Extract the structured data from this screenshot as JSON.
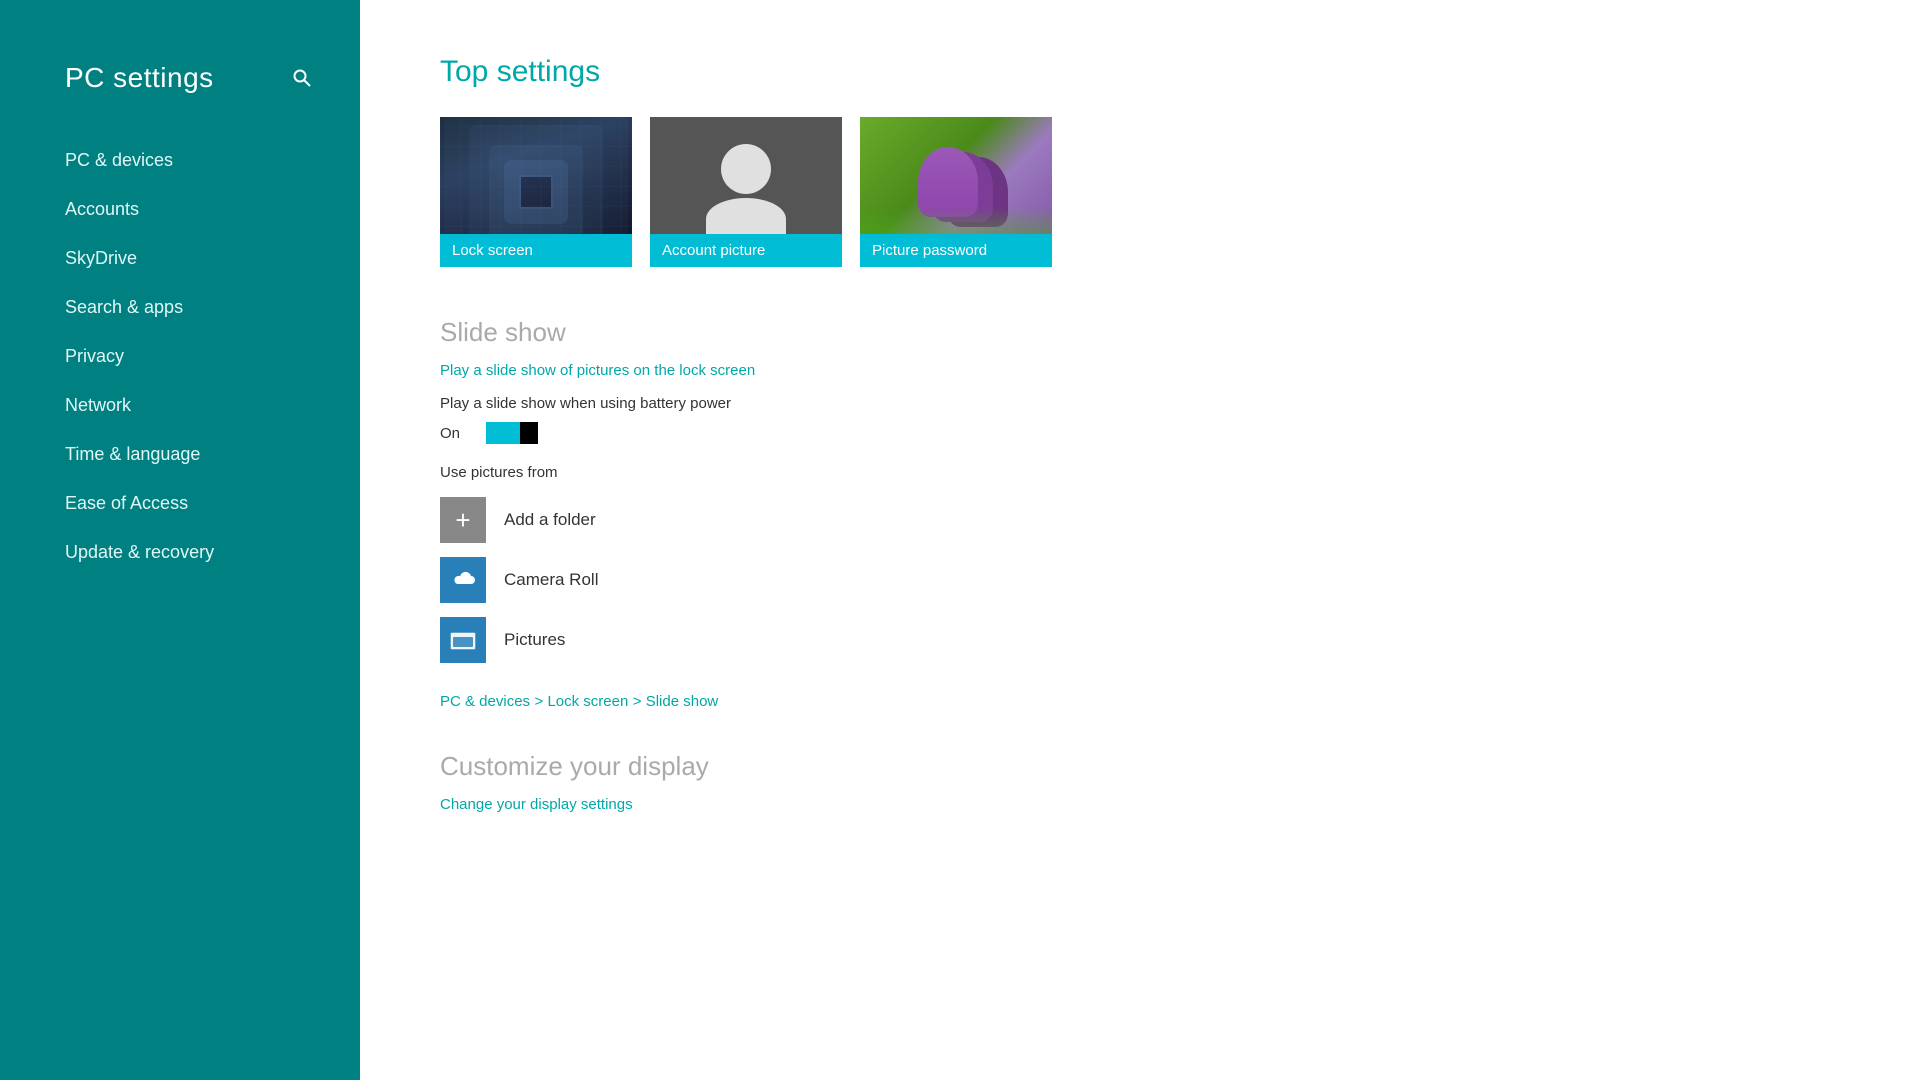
{
  "sidebar": {
    "title": "PC settings",
    "search_icon": "🔍",
    "nav_items": [
      {
        "id": "pc-devices",
        "label": "PC & devices",
        "active": false
      },
      {
        "id": "accounts",
        "label": "Accounts",
        "active": false
      },
      {
        "id": "skydrive",
        "label": "SkyDrive",
        "active": false
      },
      {
        "id": "search-apps",
        "label": "Search & apps",
        "active": false
      },
      {
        "id": "privacy",
        "label": "Privacy",
        "active": false
      },
      {
        "id": "network",
        "label": "Network",
        "active": false
      },
      {
        "id": "time-language",
        "label": "Time & language",
        "active": false
      },
      {
        "id": "ease-of-access",
        "label": "Ease of Access",
        "active": false
      },
      {
        "id": "update-recovery",
        "label": "Update & recovery",
        "active": false
      }
    ]
  },
  "main": {
    "top_settings_title": "Top settings",
    "cards": [
      {
        "id": "lock-screen",
        "label": "Lock screen"
      },
      {
        "id": "account-picture",
        "label": "Account picture"
      },
      {
        "id": "picture-password",
        "label": "Picture password"
      }
    ],
    "slideshow": {
      "section_title": "Slide show",
      "link_text": "Play a slide show of pictures on the lock screen",
      "battery_label": "Play a slide show when using battery power",
      "toggle_label": "On",
      "toggle_on": true,
      "use_pictures_label": "Use pictures from",
      "folders": [
        {
          "id": "add-folder",
          "type": "add",
          "label": "Add a folder"
        },
        {
          "id": "camera-roll",
          "type": "camera",
          "label": "Camera Roll"
        },
        {
          "id": "pictures",
          "type": "pictures",
          "label": "Pictures"
        }
      ]
    },
    "breadcrumb": {
      "text": "PC & devices > Lock screen > Slide show",
      "parts": [
        "PC & devices",
        " > ",
        "Lock screen",
        " > ",
        "Slide show"
      ]
    },
    "customize": {
      "section_title": "Customize your display",
      "link_text": "Change your display settings"
    }
  }
}
